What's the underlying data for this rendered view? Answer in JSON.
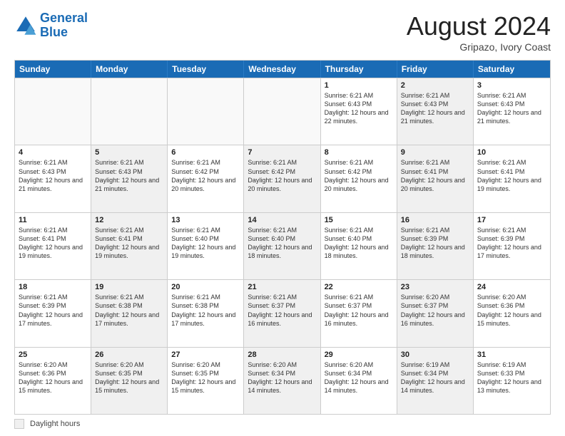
{
  "header": {
    "logo_line1": "General",
    "logo_line2": "Blue",
    "main_title": "August 2024",
    "subtitle": "Gripazo, Ivory Coast"
  },
  "calendar": {
    "days_of_week": [
      "Sunday",
      "Monday",
      "Tuesday",
      "Wednesday",
      "Thursday",
      "Friday",
      "Saturday"
    ],
    "rows": [
      {
        "cells": [
          {
            "day": "",
            "text": "",
            "empty": true
          },
          {
            "day": "",
            "text": "",
            "empty": true
          },
          {
            "day": "",
            "text": "",
            "empty": true
          },
          {
            "day": "",
            "text": "",
            "empty": true
          },
          {
            "day": "1",
            "text": "Sunrise: 6:21 AM\nSunset: 6:43 PM\nDaylight: 12 hours and 22 minutes.",
            "empty": false,
            "shaded": false
          },
          {
            "day": "2",
            "text": "Sunrise: 6:21 AM\nSunset: 6:43 PM\nDaylight: 12 hours and 21 minutes.",
            "empty": false,
            "shaded": true
          },
          {
            "day": "3",
            "text": "Sunrise: 6:21 AM\nSunset: 6:43 PM\nDaylight: 12 hours and 21 minutes.",
            "empty": false,
            "shaded": false
          }
        ]
      },
      {
        "cells": [
          {
            "day": "4",
            "text": "Sunrise: 6:21 AM\nSunset: 6:43 PM\nDaylight: 12 hours and 21 minutes.",
            "empty": false,
            "shaded": false
          },
          {
            "day": "5",
            "text": "Sunrise: 6:21 AM\nSunset: 6:43 PM\nDaylight: 12 hours and 21 minutes.",
            "empty": false,
            "shaded": true
          },
          {
            "day": "6",
            "text": "Sunrise: 6:21 AM\nSunset: 6:42 PM\nDaylight: 12 hours and 20 minutes.",
            "empty": false,
            "shaded": false
          },
          {
            "day": "7",
            "text": "Sunrise: 6:21 AM\nSunset: 6:42 PM\nDaylight: 12 hours and 20 minutes.",
            "empty": false,
            "shaded": true
          },
          {
            "day": "8",
            "text": "Sunrise: 6:21 AM\nSunset: 6:42 PM\nDaylight: 12 hours and 20 minutes.",
            "empty": false,
            "shaded": false
          },
          {
            "day": "9",
            "text": "Sunrise: 6:21 AM\nSunset: 6:41 PM\nDaylight: 12 hours and 20 minutes.",
            "empty": false,
            "shaded": true
          },
          {
            "day": "10",
            "text": "Sunrise: 6:21 AM\nSunset: 6:41 PM\nDaylight: 12 hours and 19 minutes.",
            "empty": false,
            "shaded": false
          }
        ]
      },
      {
        "cells": [
          {
            "day": "11",
            "text": "Sunrise: 6:21 AM\nSunset: 6:41 PM\nDaylight: 12 hours and 19 minutes.",
            "empty": false,
            "shaded": false
          },
          {
            "day": "12",
            "text": "Sunrise: 6:21 AM\nSunset: 6:41 PM\nDaylight: 12 hours and 19 minutes.",
            "empty": false,
            "shaded": true
          },
          {
            "day": "13",
            "text": "Sunrise: 6:21 AM\nSunset: 6:40 PM\nDaylight: 12 hours and 19 minutes.",
            "empty": false,
            "shaded": false
          },
          {
            "day": "14",
            "text": "Sunrise: 6:21 AM\nSunset: 6:40 PM\nDaylight: 12 hours and 18 minutes.",
            "empty": false,
            "shaded": true
          },
          {
            "day": "15",
            "text": "Sunrise: 6:21 AM\nSunset: 6:40 PM\nDaylight: 12 hours and 18 minutes.",
            "empty": false,
            "shaded": false
          },
          {
            "day": "16",
            "text": "Sunrise: 6:21 AM\nSunset: 6:39 PM\nDaylight: 12 hours and 18 minutes.",
            "empty": false,
            "shaded": true
          },
          {
            "day": "17",
            "text": "Sunrise: 6:21 AM\nSunset: 6:39 PM\nDaylight: 12 hours and 17 minutes.",
            "empty": false,
            "shaded": false
          }
        ]
      },
      {
        "cells": [
          {
            "day": "18",
            "text": "Sunrise: 6:21 AM\nSunset: 6:39 PM\nDaylight: 12 hours and 17 minutes.",
            "empty": false,
            "shaded": false
          },
          {
            "day": "19",
            "text": "Sunrise: 6:21 AM\nSunset: 6:38 PM\nDaylight: 12 hours and 17 minutes.",
            "empty": false,
            "shaded": true
          },
          {
            "day": "20",
            "text": "Sunrise: 6:21 AM\nSunset: 6:38 PM\nDaylight: 12 hours and 17 minutes.",
            "empty": false,
            "shaded": false
          },
          {
            "day": "21",
            "text": "Sunrise: 6:21 AM\nSunset: 6:37 PM\nDaylight: 12 hours and 16 minutes.",
            "empty": false,
            "shaded": true
          },
          {
            "day": "22",
            "text": "Sunrise: 6:21 AM\nSunset: 6:37 PM\nDaylight: 12 hours and 16 minutes.",
            "empty": false,
            "shaded": false
          },
          {
            "day": "23",
            "text": "Sunrise: 6:20 AM\nSunset: 6:37 PM\nDaylight: 12 hours and 16 minutes.",
            "empty": false,
            "shaded": true
          },
          {
            "day": "24",
            "text": "Sunrise: 6:20 AM\nSunset: 6:36 PM\nDaylight: 12 hours and 15 minutes.",
            "empty": false,
            "shaded": false
          }
        ]
      },
      {
        "cells": [
          {
            "day": "25",
            "text": "Sunrise: 6:20 AM\nSunset: 6:36 PM\nDaylight: 12 hours and 15 minutes.",
            "empty": false,
            "shaded": false
          },
          {
            "day": "26",
            "text": "Sunrise: 6:20 AM\nSunset: 6:35 PM\nDaylight: 12 hours and 15 minutes.",
            "empty": false,
            "shaded": true
          },
          {
            "day": "27",
            "text": "Sunrise: 6:20 AM\nSunset: 6:35 PM\nDaylight: 12 hours and 15 minutes.",
            "empty": false,
            "shaded": false
          },
          {
            "day": "28",
            "text": "Sunrise: 6:20 AM\nSunset: 6:34 PM\nDaylight: 12 hours and 14 minutes.",
            "empty": false,
            "shaded": true
          },
          {
            "day": "29",
            "text": "Sunrise: 6:20 AM\nSunset: 6:34 PM\nDaylight: 12 hours and 14 minutes.",
            "empty": false,
            "shaded": false
          },
          {
            "day": "30",
            "text": "Sunrise: 6:19 AM\nSunset: 6:34 PM\nDaylight: 12 hours and 14 minutes.",
            "empty": false,
            "shaded": true
          },
          {
            "day": "31",
            "text": "Sunrise: 6:19 AM\nSunset: 6:33 PM\nDaylight: 12 hours and 13 minutes.",
            "empty": false,
            "shaded": false
          }
        ]
      }
    ]
  },
  "legend": {
    "label": "Daylight hours"
  }
}
